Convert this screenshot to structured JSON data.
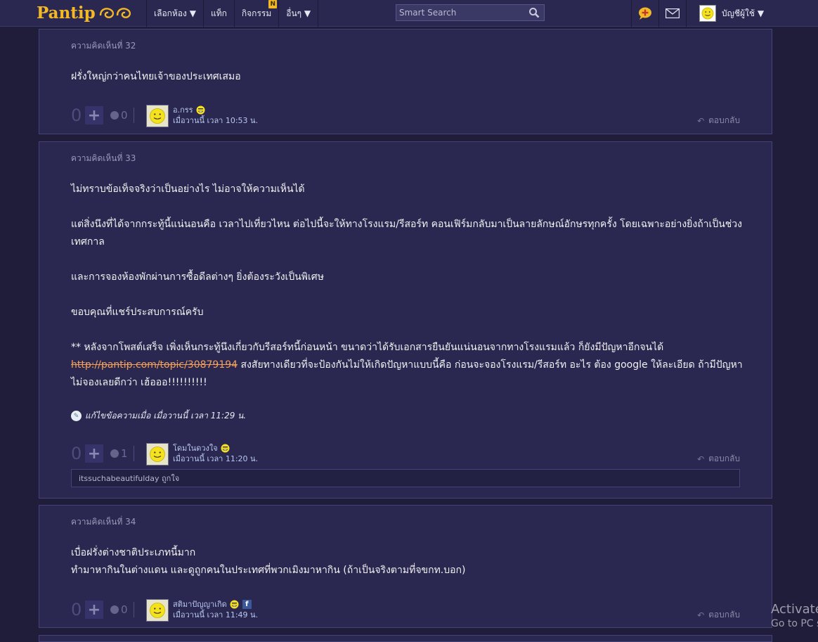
{
  "header": {
    "logo_text": "Pantip",
    "nav": [
      {
        "label": "เลือกห้อง ▼"
      },
      {
        "label": "แท็ก"
      },
      {
        "label": "กิจกรรม",
        "badge": "N"
      },
      {
        "label": "อื่นๆ ▼"
      }
    ],
    "search_placeholder": "Smart Search",
    "user_label": "บัญชีผู้ใช้ ▼"
  },
  "comments": [
    {
      "label": "ความคิดเห็นที่ 32",
      "paragraphs": [
        "ฝรั่งใหญ่กว่าคนไทยเจ้าของประเทศเสมอ"
      ],
      "votes": "0",
      "emotions": "0",
      "author": "อ.กรร",
      "time": "เมื่อวานนี้ เวลา 10:53 น.",
      "reply_label": "ตอบกลับ"
    },
    {
      "label": "ความคิดเห็นที่ 33",
      "paragraphs": [
        "ไม่ทราบข้อเท็จจริงว่าเป็นอย่างไร  ไม่อาจให้ความเห็นได้",
        "แต่สิ่งนึงที่ได้จากกระทู้นี้แน่นอนคือ  เวลาไปเที่ยวไหน ต่อไปนี้จะให้ทางโรงแรม/รีสอร์ท คอนเฟิร์มกลับมาเป็นลายลักษณ์อักษรทุกครั้ง  โดยเฉพาะอย่างยิ่งถ้าเป็นช่วงเทศกาล",
        "และการจองห้องพักผ่านการซื้อดีลต่างๆ ยิ่งต้องระวังเป็นพิเศษ",
        "ขอบคุณที่แชร์ประสบการณ์ครับ"
      ],
      "note_prefix": "**  หลังจากโพสต์เสร็จ  เพิ่งเห็นกระทู้นึงเกี่ยวกับรีสอร์ทนี้ก่อนหน้า    ขนาดว่าได้รับเอกสารยืนยันแน่นอนจากทางโรงแรมแล้ว  ก็ยังมีปัญหาอีกจนได้ ",
      "note_link": "http://pantip.com/topic/30879194",
      "note_suffix": "   สงสัยทางเดียวที่จะป้องกันไม่ให้เกิดปัญหาแบบนี้คือ  ก่อนจะจองโรงแรม/รีสอร์ท อะไร ต้อง google ให้ละเอียด   ถ้ามีปัญหา   ไม่จองเลยดีกว่า  เฮ้อออ!!!!!!!!!!",
      "edited": "แก้ไขข้อความเมื่อ เมื่อวานนี้ เวลา 11:29 น.",
      "votes": "0",
      "emotions": "1",
      "author": "โดมในดวงใจ",
      "time": "เมื่อวานนี้ เวลา 11:20 น.",
      "reply_label": "ตอบกลับ",
      "subreply": "itssuchabeautifulday ถูกใจ"
    },
    {
      "label": "ความคิดเห็นที่ 34",
      "paragraphs": [
        "เบื่อฝรั่งต่างชาติประเภทนี้มาก",
        "ทำมาหากินในต่างแดน และดูถูกคนในประเทศที่พวกเมิงมาหากิน (ถ้าเป็นจริงตามที่จขกท.บอก)"
      ],
      "votes": "0",
      "emotions": "0",
      "author": "สติมาปัญญาเกิด",
      "time": "เมื่อวานนี้ เวลา 11:49 น.",
      "reply_label": "ตอบกลับ",
      "fb_letter": "f"
    }
  ],
  "watermark": {
    "line1": "Activate",
    "line2": "Go to PC s"
  }
}
